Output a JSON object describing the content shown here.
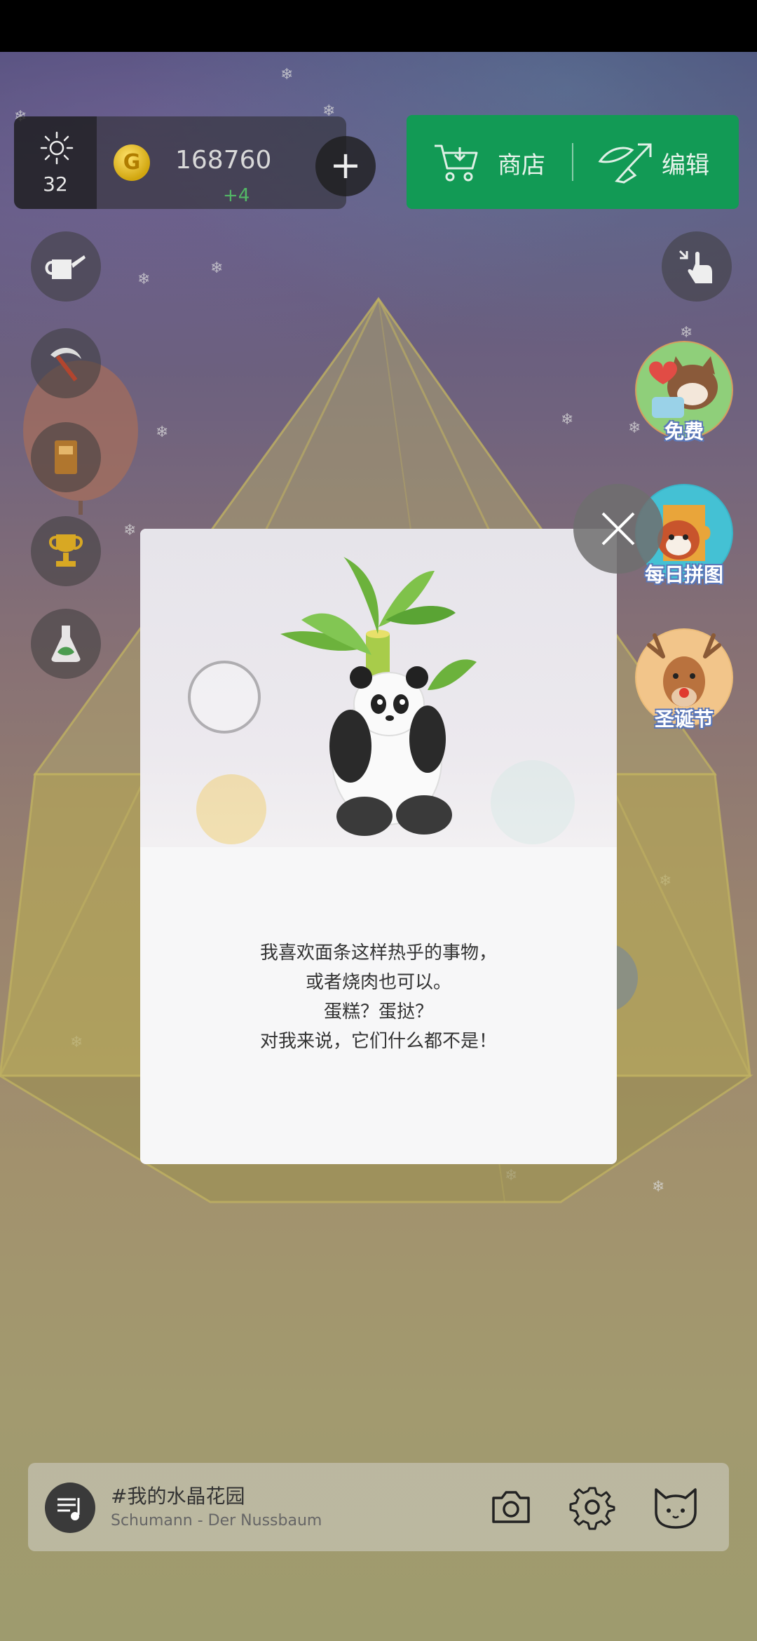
{
  "resources": {
    "sun_count": "32",
    "gold_amount": "168760",
    "gold_delta": "+4",
    "coin_letter": "G"
  },
  "toolbar": {
    "shop_label": "商店",
    "edit_label": "编辑"
  },
  "events": [
    {
      "label": "免费",
      "icon": "cat-reward-icon"
    },
    {
      "label": "每日拼图",
      "icon": "red-panda-puzzle-icon"
    },
    {
      "label": "圣诞节",
      "icon": "reindeer-icon"
    }
  ],
  "side_tools": [
    "watering-can-icon",
    "sickle-icon",
    "book-icon",
    "trophy-icon",
    "flask-icon"
  ],
  "dialog": {
    "lines": [
      "我喜欢面条这样热乎的事物，",
      "或者烧肉也可以。",
      "蛋糕？蛋挞？",
      "对我来说，它们什么都不是！"
    ]
  },
  "music": {
    "title": "#我的水晶花园",
    "track": "Schumann - Der Nussbaum"
  },
  "colors": {
    "accent_green": "#129a55",
    "gold_delta": "#53b866"
  }
}
